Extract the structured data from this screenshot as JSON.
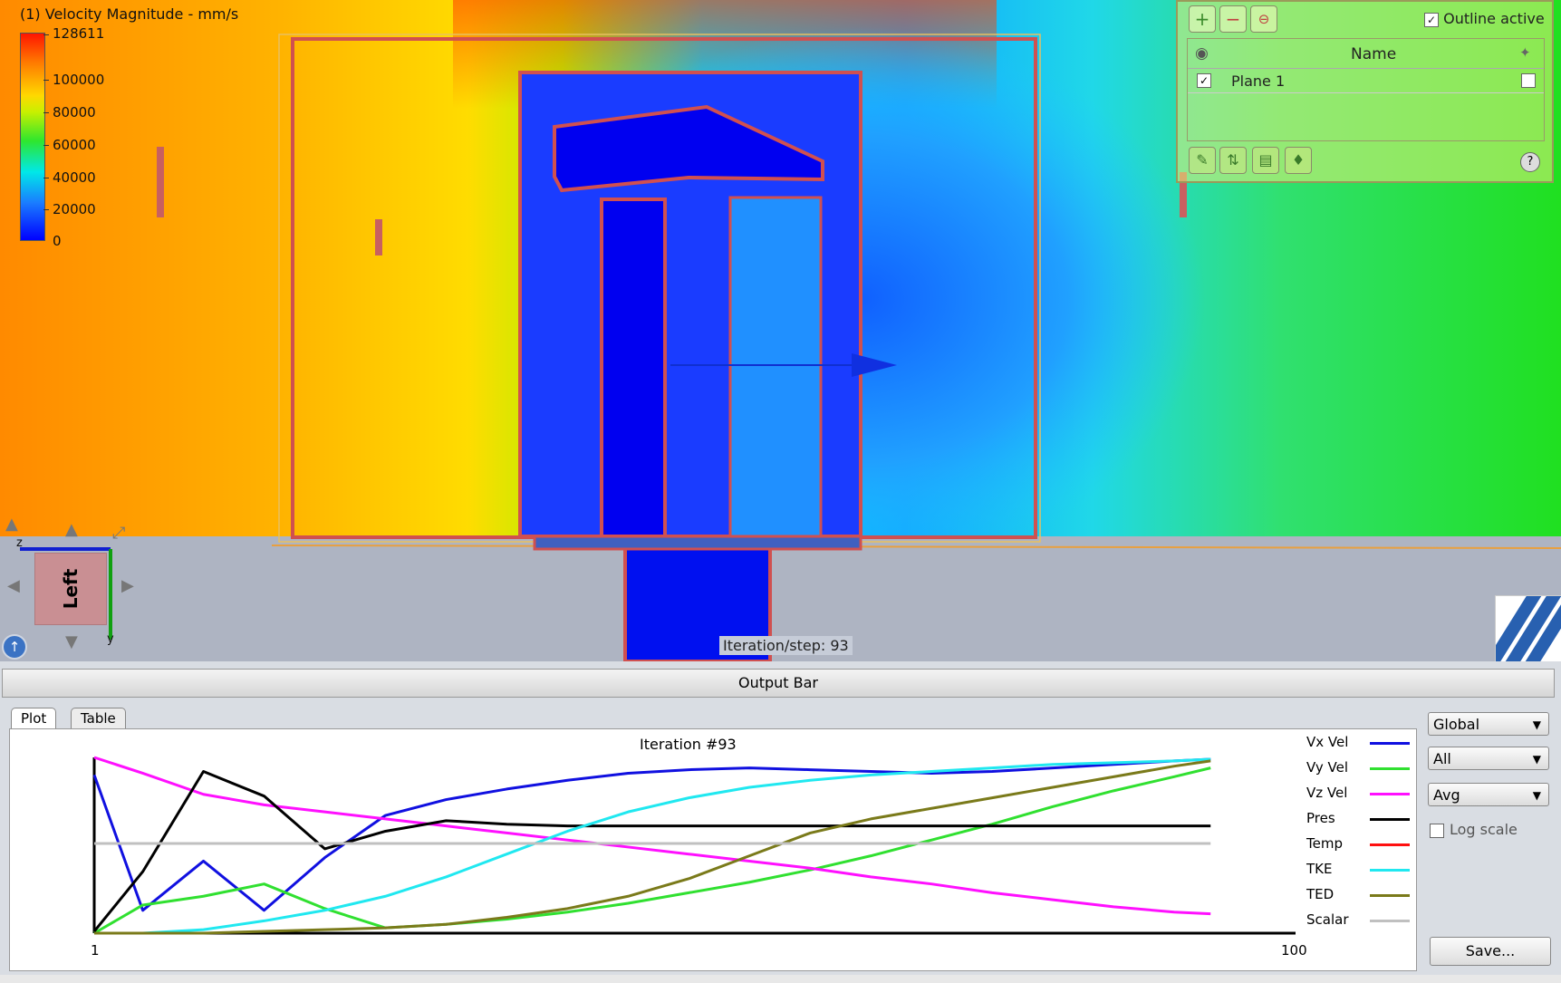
{
  "viewport": {
    "legend_title": "(1) Velocity Magnitude - mm/s",
    "legend_max": "128611",
    "legend_ticks": [
      "100000",
      "80000",
      "60000",
      "40000",
      "20000",
      "0"
    ],
    "view_cube_label": "Left",
    "axis_z_label": "z",
    "axis_y_label": "y",
    "iteration_status": "Iteration/step: 93"
  },
  "planes_panel": {
    "outline_active_label": "Outline active",
    "outline_active_checked": true,
    "column_name": "Name",
    "planes": [
      {
        "name": "Plane 1",
        "visible": true,
        "flag": false
      }
    ]
  },
  "output": {
    "bar_label": "Output Bar",
    "tabs": [
      "Plot",
      "Table"
    ],
    "active_tab": "Plot",
    "dropdowns": [
      "Global",
      "All",
      "Avg"
    ],
    "log_scale_label": "Log scale",
    "log_scale_checked": false,
    "save_label": "Save..."
  },
  "chart_data": {
    "type": "line",
    "title": "Iteration #93",
    "xlabel": "",
    "ylabel": "",
    "x_tick_labels": [
      "1",
      "100"
    ],
    "x": [
      1,
      5,
      10,
      15,
      20,
      25,
      30,
      35,
      40,
      45,
      50,
      55,
      60,
      65,
      70,
      75,
      80,
      85,
      90,
      93
    ],
    "ylim": [
      0,
      1
    ],
    "series": [
      {
        "name": "Vx Vel",
        "color": "#1010e0",
        "values": [
          0.9,
          0.13,
          0.41,
          0.13,
          0.43,
          0.67,
          0.76,
          0.82,
          0.87,
          0.91,
          0.93,
          0.94,
          0.93,
          0.92,
          0.91,
          0.92,
          0.94,
          0.96,
          0.98,
          0.99
        ]
      },
      {
        "name": "Vy Vel",
        "color": "#30e030",
        "values": [
          0.0,
          0.16,
          0.21,
          0.28,
          0.14,
          0.03,
          0.05,
          0.08,
          0.12,
          0.17,
          0.23,
          0.29,
          0.36,
          0.44,
          0.53,
          0.62,
          0.72,
          0.81,
          0.89,
          0.94
        ]
      },
      {
        "name": "Vz Vel",
        "color": "#ff10ff",
        "values": [
          1.0,
          0.91,
          0.79,
          0.73,
          0.69,
          0.65,
          0.61,
          0.57,
          0.53,
          0.49,
          0.45,
          0.41,
          0.37,
          0.32,
          0.28,
          0.23,
          0.19,
          0.15,
          0.12,
          0.11
        ]
      },
      {
        "name": "Pres",
        "color": "#000000",
        "values": [
          0.01,
          0.35,
          0.92,
          0.78,
          0.48,
          0.58,
          0.64,
          0.62,
          0.61,
          0.61,
          0.61,
          0.61,
          0.61,
          0.61,
          0.61,
          0.61,
          0.61,
          0.61,
          0.61,
          0.61
        ]
      },
      {
        "name": "Temp",
        "color": "#ff1010",
        "values": []
      },
      {
        "name": "TKE",
        "color": "#20e8f0",
        "values": [
          0.0,
          0.0,
          0.02,
          0.07,
          0.13,
          0.21,
          0.32,
          0.45,
          0.58,
          0.69,
          0.77,
          0.83,
          0.87,
          0.9,
          0.92,
          0.94,
          0.96,
          0.97,
          0.98,
          0.99
        ]
      },
      {
        "name": "TED",
        "color": "#7a7a1a",
        "values": [
          0.0,
          0.0,
          0.0,
          0.01,
          0.02,
          0.03,
          0.05,
          0.09,
          0.14,
          0.21,
          0.31,
          0.44,
          0.57,
          0.65,
          0.71,
          0.77,
          0.83,
          0.89,
          0.95,
          0.98
        ]
      },
      {
        "name": "Scalar",
        "color": "#c0c0c0",
        "values": [
          0.51,
          0.51,
          0.51,
          0.51,
          0.51,
          0.51,
          0.51,
          0.51,
          0.51,
          0.51,
          0.51,
          0.51,
          0.51,
          0.51,
          0.51,
          0.51,
          0.51,
          0.51,
          0.51,
          0.51
        ]
      }
    ]
  }
}
